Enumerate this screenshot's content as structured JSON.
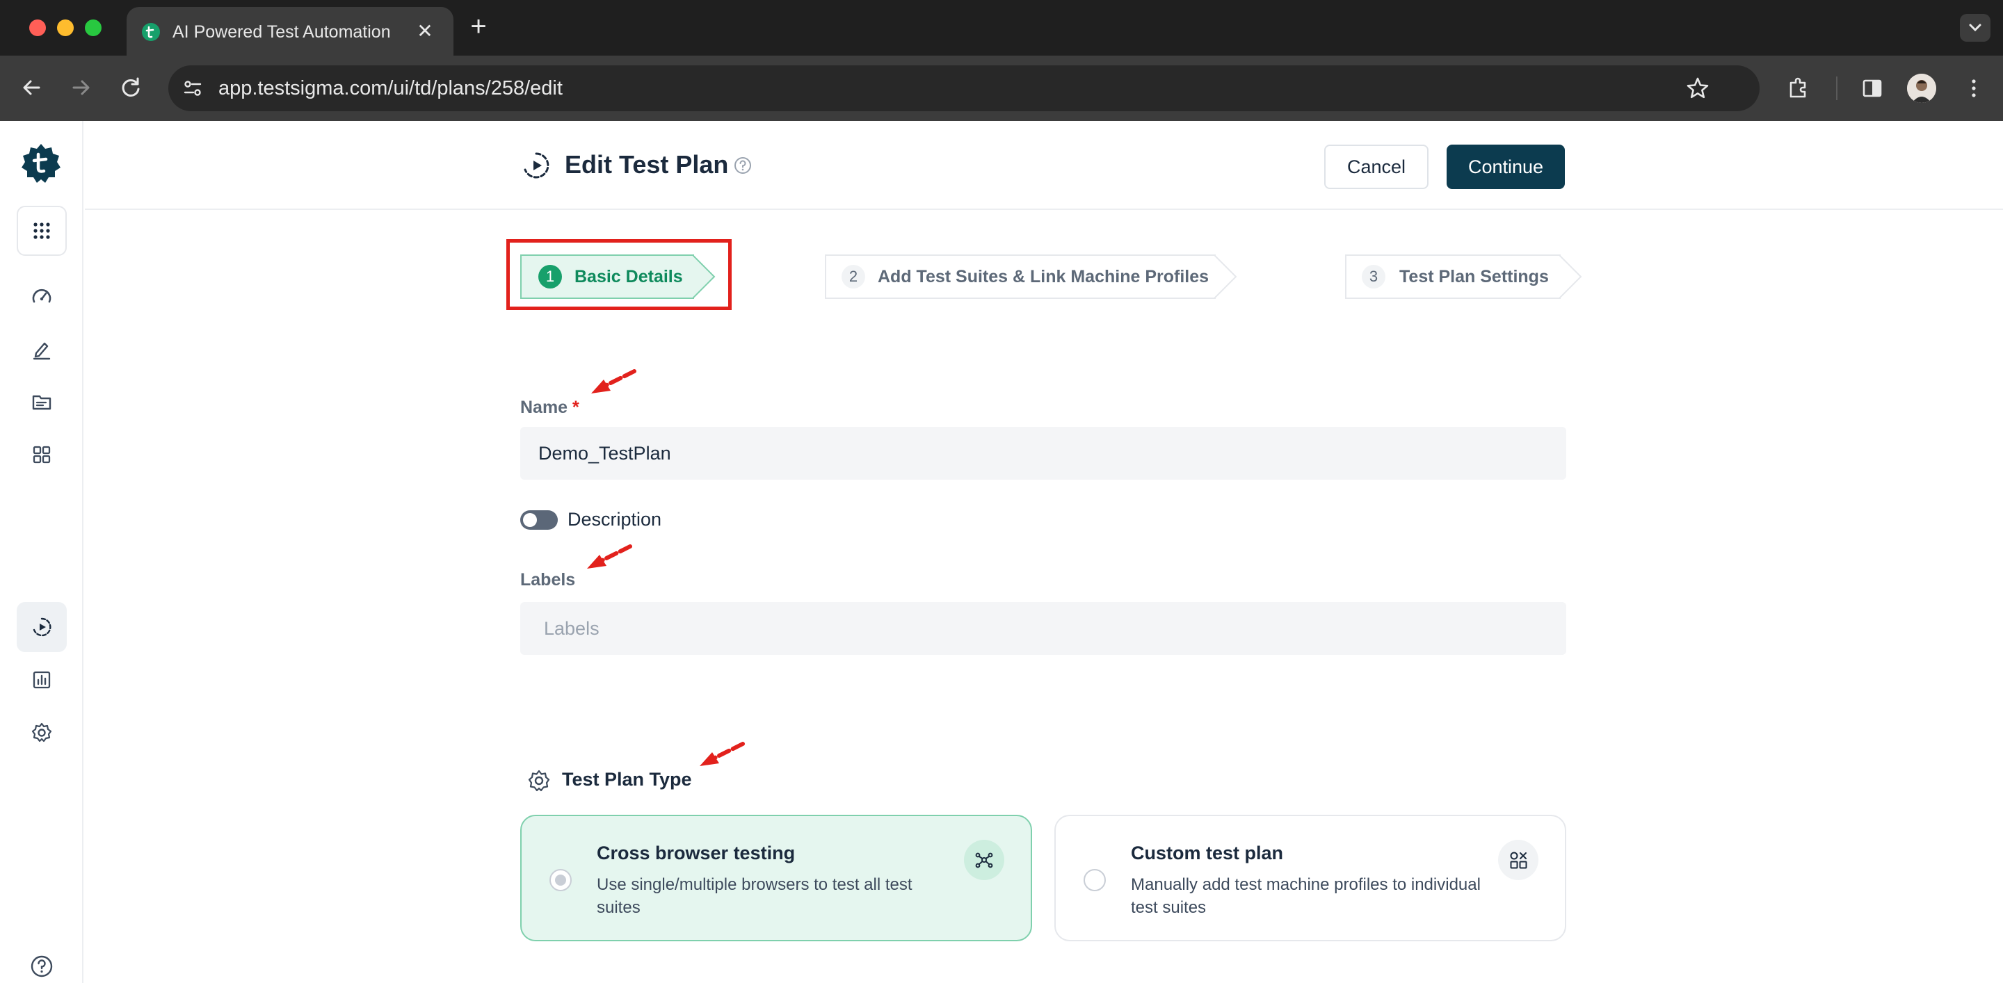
{
  "browser": {
    "tab_title": "AI Powered Test Automation",
    "url": "app.testsigma.com/ui/td/plans/258/edit"
  },
  "header": {
    "title": "Edit Test Plan",
    "cancel_label": "Cancel",
    "continue_label": "Continue"
  },
  "stepper": {
    "steps": [
      {
        "number": "1",
        "label": "Basic Details"
      },
      {
        "number": "2",
        "label": "Add Test Suites & Link Machine Profiles"
      },
      {
        "number": "3",
        "label": "Test Plan Settings"
      }
    ],
    "active_step": 1
  },
  "form": {
    "name_label": "Name",
    "name_required_mark": "*",
    "name_value": "Demo_TestPlan",
    "description_toggle_label": "Description",
    "description_enabled": false,
    "labels_label": "Labels",
    "labels_placeholder": "Labels"
  },
  "plan_type": {
    "section_title": "Test Plan Type",
    "options": [
      {
        "title": "Cross browser testing",
        "description": "Use single/multiple browsers to test all test suites",
        "icon": "network-nodes-icon",
        "selected": true
      },
      {
        "title": "Custom test plan",
        "description": "Manually add test machine profiles to individual test suites",
        "icon": "custom-shapes-icon",
        "selected": false
      }
    ]
  },
  "sidebar": {
    "items": [
      "apps-grid-icon",
      "dashboard-gauge-icon",
      "pen-edit-icon",
      "folder-icon",
      "modules-grid-icon",
      "test-plan-icon",
      "reports-icon",
      "settings-icon",
      "help-icon"
    ],
    "active_item": "test-plan-icon"
  },
  "colors": {
    "brand_dark": "#0c3b4f",
    "brand_green": "#17a06b",
    "annotation_red": "#e2211c"
  }
}
